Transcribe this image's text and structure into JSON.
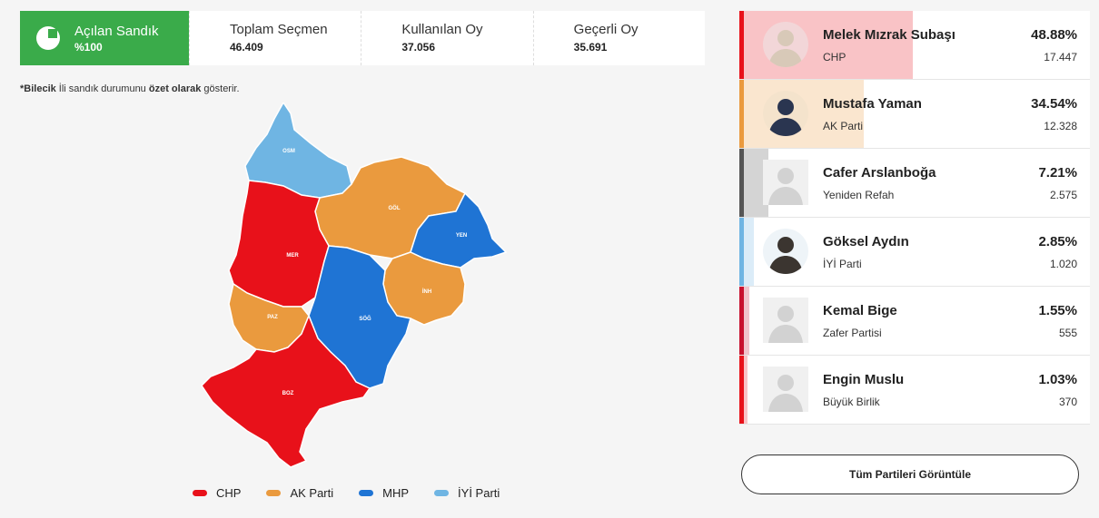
{
  "summary": {
    "opened_label": "Açılan Sandık",
    "opened_value": "%100",
    "stats": [
      {
        "label": "Toplam Seçmen",
        "value": "46.409"
      },
      {
        "label": "Kullanılan Oy",
        "value": "37.056"
      },
      {
        "label": "Geçerli Oy",
        "value": "35.691"
      }
    ]
  },
  "note": {
    "bold": "*Bilecik",
    "text": " İli sandık durumunu ",
    "bold2": "özet olarak",
    "text2": " gösterir."
  },
  "map": {
    "districts": [
      {
        "code": "OSM",
        "party": "IYI"
      },
      {
        "code": "GÖL",
        "party": "AKP"
      },
      {
        "code": "YEN",
        "party": "MHP"
      },
      {
        "code": "MER",
        "party": "CHP"
      },
      {
        "code": "İNH",
        "party": "AKP"
      },
      {
        "code": "PAZ",
        "party": "AKP"
      },
      {
        "code": "SÖĞ",
        "party": "MHP"
      },
      {
        "code": "BOZ",
        "party": "CHP"
      }
    ],
    "colors": {
      "CHP": "#e8111a",
      "AKP": "#ea9a3e",
      "MHP": "#1f74d4",
      "IYI": "#6fb5e3"
    }
  },
  "legend": [
    {
      "label": "CHP",
      "color": "#e8111a"
    },
    {
      "label": "AK Parti",
      "color": "#ea9a3e"
    },
    {
      "label": "MHP",
      "color": "#1f74d4"
    },
    {
      "label": "İYİ Parti",
      "color": "#6fb5e3"
    }
  ],
  "candidates": [
    {
      "name": "Melek Mızrak Subaşı",
      "party": "CHP",
      "pct": "48.88%",
      "share": 48.88,
      "votes": "17.447",
      "color": "#e8111a",
      "photo": "female"
    },
    {
      "name": "Mustafa Yaman",
      "party": "AK Parti",
      "pct": "34.54%",
      "share": 34.54,
      "votes": "12.328",
      "color": "#ea9a3e",
      "photo": "male-suit"
    },
    {
      "name": "Cafer Arslanboğa",
      "party": "Yeniden Refah",
      "pct": "7.21%",
      "share": 7.21,
      "votes": "2.575",
      "color": "#555555",
      "photo": "placeholder"
    },
    {
      "name": "Göksel Aydın",
      "party": "İYİ Parti",
      "pct": "2.85%",
      "share": 2.85,
      "votes": "1.020",
      "color": "#6fb5e3",
      "photo": "male-beard"
    },
    {
      "name": "Kemal Bige",
      "party": "Zafer Partisi",
      "pct": "1.55%",
      "share": 1.55,
      "votes": "555",
      "color": "#c8102e",
      "photo": "placeholder"
    },
    {
      "name": "Engin Muslu",
      "party": "Büyük Birlik",
      "pct": "1.03%",
      "share": 1.03,
      "votes": "370",
      "color": "#e8111a",
      "photo": "placeholder"
    }
  ],
  "button": {
    "label": "Tüm Partileri Görüntüle"
  }
}
